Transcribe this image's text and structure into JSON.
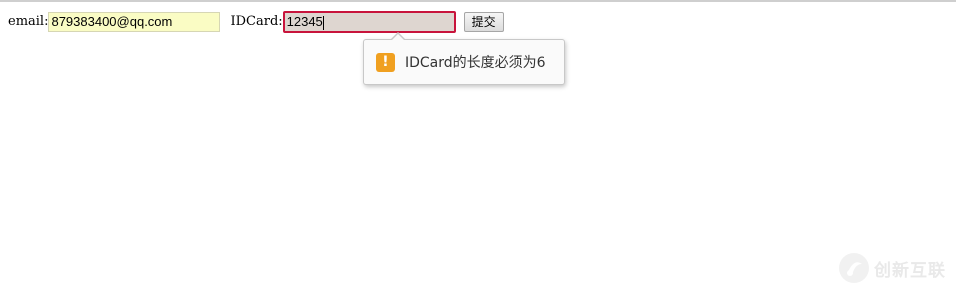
{
  "form": {
    "email_label": "email:",
    "email_value": "879383400@qq.com",
    "idcard_label": "IDCard:",
    "idcard_value": "12345",
    "submit_label": "提交"
  },
  "validation_tooltip": {
    "icon": "warning-icon",
    "message": "IDCard的长度必须为6"
  },
  "watermark": {
    "text": "创新互联"
  },
  "colors": {
    "email_autofill_bg": "#fafcc4",
    "idcard_invalid_border": "#c8143c",
    "warning_icon": "#f0a020"
  }
}
